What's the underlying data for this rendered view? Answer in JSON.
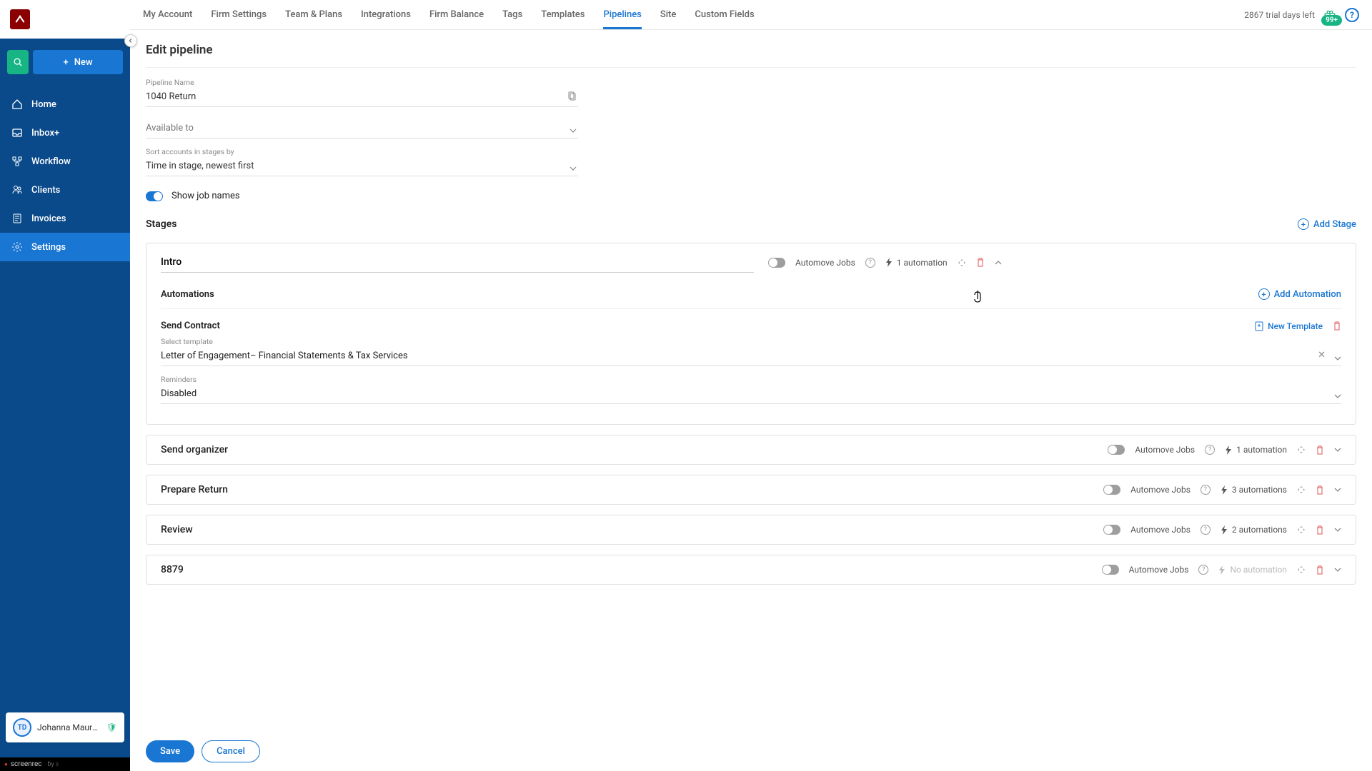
{
  "sidebar": {
    "new_label": "New",
    "items": [
      {
        "label": "Home"
      },
      {
        "label": "Inbox+"
      },
      {
        "label": "Workflow"
      },
      {
        "label": "Clients"
      },
      {
        "label": "Invoices"
      },
      {
        "label": "Settings"
      }
    ],
    "user": {
      "initials": "TD",
      "name": "Johanna Maureen B..."
    },
    "screenrec": "screenrec"
  },
  "topbar": {
    "tabs": [
      "My Account",
      "Firm Settings",
      "Team & Plans",
      "Integrations",
      "Firm Balance",
      "Tags",
      "Templates",
      "Pipelines",
      "Site",
      "Custom Fields"
    ],
    "active_tab": "Pipelines",
    "trial_text": "2867 trial days left",
    "badge": "99+"
  },
  "page": {
    "title": "Edit pipeline",
    "pipeline_name_label": "Pipeline Name",
    "pipeline_name_value": "1040 Return",
    "available_to_label": "Available to",
    "sort_label": "Sort accounts in stages by",
    "sort_value": "Time in stage, newest first",
    "show_job_names_label": "Show job names",
    "stages_title": "Stages",
    "add_stage_label": "Add Stage",
    "add_automation_label": "Add Automation",
    "automations_title": "Automations",
    "new_template_label": "New Template",
    "automove_label": "Automove Jobs",
    "save_label": "Save",
    "cancel_label": "Cancel"
  },
  "automation": {
    "title": "Send Contract",
    "select_template_label": "Select template",
    "template_value": "Letter of Engagement– Financial Statements & Tax Services",
    "reminders_label": "Reminders",
    "reminders_value": "Disabled"
  },
  "stages": [
    {
      "name": "Intro",
      "automations_text": "1 automation",
      "dim": false,
      "expanded": true
    },
    {
      "name": "Send organizer",
      "automations_text": "1 automation",
      "dim": false,
      "expanded": false
    },
    {
      "name": "Prepare Return",
      "automations_text": "3 automations",
      "dim": false,
      "expanded": false
    },
    {
      "name": "Review",
      "automations_text": "2 automations",
      "dim": false,
      "expanded": false
    },
    {
      "name": "8879",
      "automations_text": "No automation",
      "dim": true,
      "expanded": false
    }
  ]
}
